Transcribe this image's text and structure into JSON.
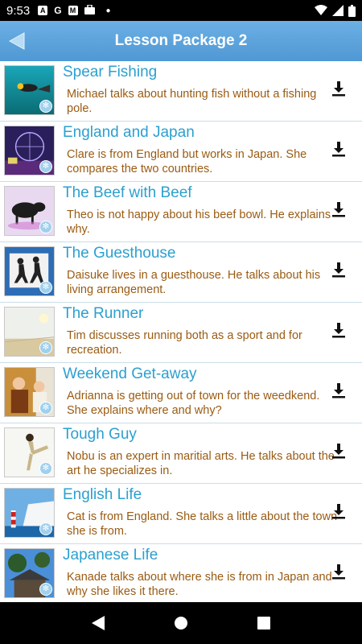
{
  "status_bar": {
    "time": "9:53",
    "icons": [
      "text-a-icon",
      "google-g-icon",
      "gmail-icon",
      "briefcase-icon",
      "dot-icon",
      "wifi-icon",
      "signal-icon",
      "battery-icon"
    ],
    "left_glyphs": [
      "A",
      "G",
      "M"
    ]
  },
  "header": {
    "title": "Lesson Package 2",
    "back_icon": "back-arrow-icon"
  },
  "lessons": [
    {
      "title": "Spear Fishing",
      "description": "Michael talks about hunting fish without a fishing pole.",
      "image": "diver-underwater"
    },
    {
      "title": "England and Japan",
      "description": "Clare is from England but works in Japan. She compares the two countries.",
      "image": "london-eye-night"
    },
    {
      "title": "The Beef with Beef",
      "description": "Theo is not happy about his beef bowl. He explains why.",
      "image": "cows"
    },
    {
      "title": "The Guesthouse",
      "description": "Daisuke lives in a guesthouse. He talks about his living arrangement.",
      "image": "pedestrian-sign"
    },
    {
      "title": "The Runner",
      "description": "Tim discusses running both as a sport and for recreation.",
      "image": "runner-track"
    },
    {
      "title": "Weekend Get-away",
      "description": "Adrianna is getting out of town for the weedkend. She explains where and why?",
      "image": "friends-cafe"
    },
    {
      "title": "Tough Guy",
      "description": "Nobu is an expert in maritial arts. He talks about the art he specializes in.",
      "image": "martial-arts-kick"
    },
    {
      "title": "English Life",
      "description": "Cat is from England. She talks a little about the town she is from.",
      "image": "lighthouse-cliffs"
    },
    {
      "title": "Japanese Life",
      "description": "Kanade talks about where she is from in Japan and why she likes it there.",
      "image": "japanese-house"
    }
  ],
  "colors": {
    "header_bg": "#5aa3dc",
    "title_text": "#2ba0cf",
    "description_text": "#9a5b12",
    "divider": "#c9dfe8"
  },
  "nav": {
    "buttons": [
      "back-triangle-icon",
      "home-circle-icon",
      "recents-square-icon"
    ]
  }
}
